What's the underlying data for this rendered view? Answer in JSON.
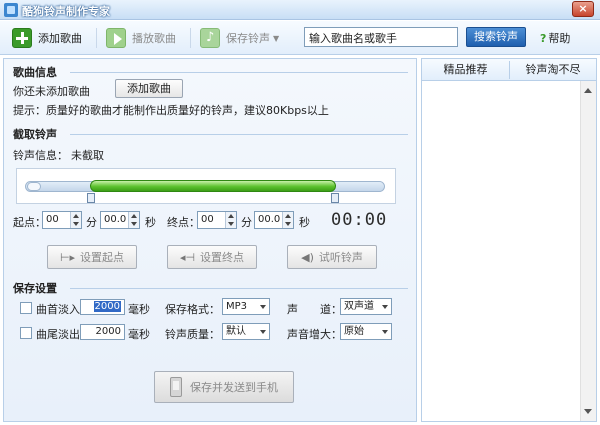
{
  "window": {
    "title": "酷狗铃声制作专家",
    "close": "×"
  },
  "toolbar": {
    "add_song": "添加歌曲",
    "play_song": "播放歌曲",
    "save_ringtone": "保存铃声",
    "search_value": "输入歌曲名或歌手",
    "search_button": "搜索铃声",
    "help_icon": "?",
    "help": "帮助"
  },
  "song_info": {
    "title": "歌曲信息",
    "status": "你还未添加歌曲",
    "add_button": "添加歌曲",
    "tip": "提示：质量好的歌曲才能制作出质量好的铃声，建议80Kbps以上"
  },
  "cut": {
    "title": "截取铃声",
    "info_label": "铃声信息：",
    "info_value": "未截取",
    "start_label": "起点：",
    "start_min": "00",
    "min_unit": "分",
    "start_sec": "00.0",
    "sec_unit": "秒",
    "end_label": "终点：",
    "end_min": "00",
    "end_sec": "00.0",
    "timer": "00:00",
    "set_start": "设置起点",
    "set_end": "设置终点",
    "preview": "试听铃声"
  },
  "save": {
    "title": "保存设置",
    "fade_in_label": "曲首淡入",
    "fade_in_value": "2000",
    "fade_out_label": "曲尾淡出",
    "fade_out_value": "2000",
    "ms_unit": "毫秒",
    "format_label": "保存格式：",
    "format_value": "MP3",
    "channel_label": "声　　道：",
    "channel_value": "双声道",
    "quality_label": "铃声质量：",
    "quality_value": "默认",
    "gain_label": "声音增大：",
    "gain_value": "原始",
    "send_button": "保存并发送到手机"
  },
  "right_panel": {
    "tabs": [
      "精品推荐",
      "铃声淘不尽"
    ]
  },
  "icons": {
    "app": "app-icon",
    "add": "add-icon",
    "play": "play-icon",
    "save": "music-note-icon",
    "help": "help-icon",
    "phone": "phone-icon"
  },
  "colors": {
    "accent": "#1f5fae",
    "range_green": "#5cc22e",
    "panel_bg": "#eef4fb"
  }
}
